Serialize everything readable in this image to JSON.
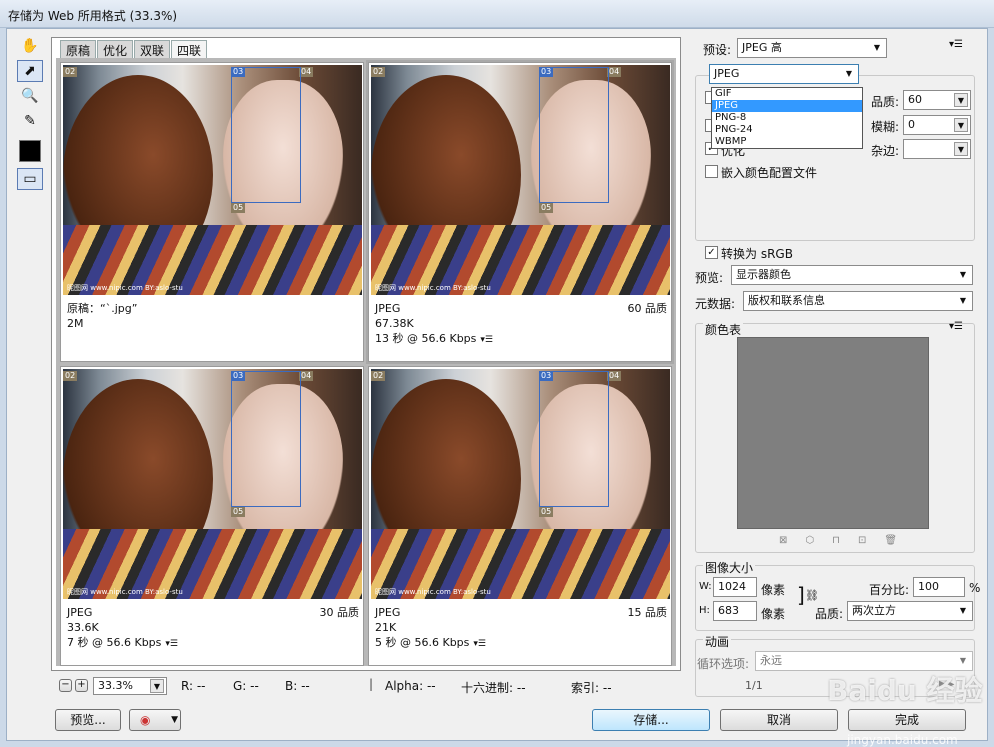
{
  "window": {
    "title": "存储为 Web 所用格式 (33.3%)"
  },
  "tabs": [
    "原稿",
    "优化",
    "双联",
    "四联"
  ],
  "panes": [
    {
      "slices": [
        "02",
        "03",
        "04",
        "05"
      ],
      "line1": "原稿：“`.jpg”",
      "line2": "2M",
      "line3": "",
      "right": "",
      "watermark": "昵图网 www.nipic.com  BY:aslo-stu"
    },
    {
      "slices": [
        "02",
        "03",
        "04",
        "05"
      ],
      "line1": "JPEG",
      "line2": "67.38K",
      "line3": "13 秒 @ 56.6 Kbps",
      "right": "60 品质",
      "watermark": "昵图网 www.nipic.com  BY:aslo-stu"
    },
    {
      "slices": [
        "02",
        "03",
        "04",
        "05"
      ],
      "line1": "JPEG",
      "line2": "33.6K",
      "line3": "7 秒 @ 56.6 Kbps",
      "right": "30 品质",
      "watermark": "昵图网 www.nipic.com  BY:aslo-stu"
    },
    {
      "slices": [
        "02",
        "03",
        "04",
        "05"
      ],
      "line1": "JPEG",
      "line2": "21K",
      "line3": "5 秒 @ 56.6 Kbps",
      "right": "15 品质",
      "watermark": "昵图网 www.nipic.com  BY:aslo-stu"
    }
  ],
  "bottom": {
    "zoom": "33.3%",
    "r": "R: --",
    "g": "G: --",
    "b": "B: --",
    "alpha": "Alpha: --",
    "hex": "十六进制: --",
    "index": "索引: --"
  },
  "buttons": {
    "preview": "预览...",
    "save": "存储...",
    "cancel": "取消",
    "done": "完成"
  },
  "right": {
    "preset_label": "预设:",
    "preset_value": "JPEG 高",
    "format_value": "JPEG",
    "format_options": [
      "GIF",
      "JPEG",
      "PNG-8",
      "PNG-24",
      "WBMP"
    ],
    "quality_label": "品质:",
    "quality_value": "60",
    "blur_label": "模糊:",
    "blur_value": "0",
    "matte_label": "杂边:",
    "optimize_label": "优化",
    "embed_label": "嵌入颜色配置文件",
    "srgb_label": "转换为 sRGB",
    "preview_label": "预览:",
    "preview_value": "显示器颜色",
    "meta_label": "元数据:",
    "meta_value": "版权和联系信息",
    "colortable_label": "颜色表",
    "imgsize_label": "图像大小",
    "w_label": "W:",
    "w_value": "1024",
    "h_label": "H:",
    "h_value": "683",
    "px": "像素",
    "percent_label": "百分比:",
    "percent_value": "100",
    "percent_unit": "%",
    "quality2_label": "品质:",
    "quality2_value": "两次立方",
    "anim_label": "动画",
    "loop_label": "循环选项:",
    "loop_value": "永远",
    "frame": "1/1"
  },
  "watermark": {
    "logo": "Baidu 经验",
    "url": "jingyan.baidu.com"
  }
}
